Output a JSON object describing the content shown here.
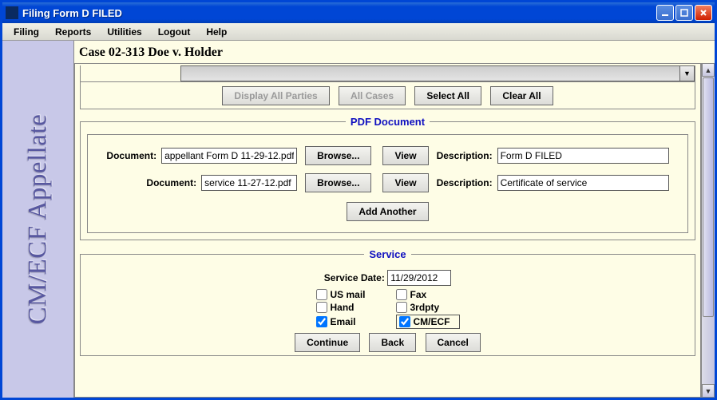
{
  "window": {
    "title": "Filing Form D FILED"
  },
  "menu": {
    "filing": "Filing",
    "reports": "Reports",
    "utilities": "Utilities",
    "logout": "Logout",
    "help": "Help"
  },
  "sidebar": {
    "brand": "CM/ECF Appellate"
  },
  "case_title": "Case 02-313 Doe v. Holder",
  "party_buttons": {
    "display_all_parties": "Display All Parties",
    "all_cases": "All Cases",
    "select_all": "Select All",
    "clear_all": "Clear All"
  },
  "pdf_section": {
    "legend": "PDF Document",
    "document_label": "Document:",
    "description_label": "Description:",
    "browse_label": "Browse...",
    "view_label": "View",
    "add_another_label": "Add Another",
    "rows": [
      {
        "file": "appellant Form D 11-29-12.pdf",
        "description": "Form D FILED"
      },
      {
        "file": "service 11-27-12.pdf",
        "description": "Certificate of service"
      }
    ]
  },
  "service_section": {
    "legend": "Service",
    "date_label": "Service Date:",
    "date_value": "11/29/2012",
    "methods": {
      "us_mail": {
        "label": "US mail",
        "checked": false
      },
      "fax": {
        "label": "Fax",
        "checked": false
      },
      "hand": {
        "label": "Hand",
        "checked": false
      },
      "thirdparty": {
        "label": "3rdpty",
        "checked": false
      },
      "email": {
        "label": "Email",
        "checked": true
      },
      "cmecf": {
        "label": "CM/ECF",
        "checked": true
      }
    }
  },
  "nav_buttons": {
    "continue": "Continue",
    "back": "Back",
    "cancel": "Cancel"
  }
}
